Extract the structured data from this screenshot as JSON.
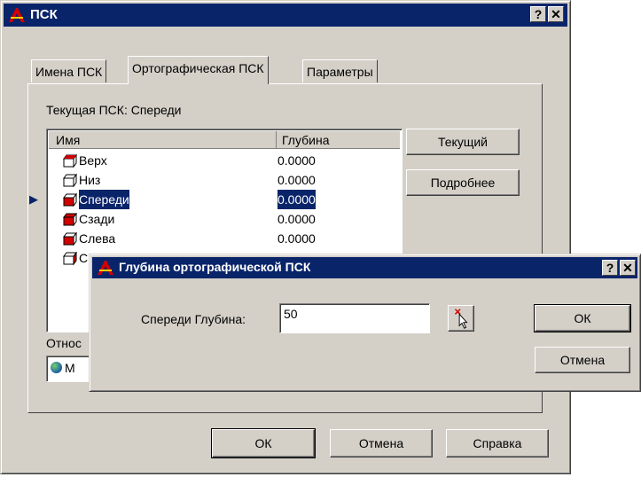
{
  "main_dialog": {
    "title": "ПСК",
    "help_btn": "?",
    "close_btn": "✕",
    "tabs": [
      "Имена ПСК",
      "Ортографическая ПСК",
      "Параметры"
    ],
    "current_label": "Текущая ПСК:  Спереди",
    "columns": {
      "name": "Имя",
      "depth": "Глубина"
    },
    "rows": [
      {
        "name": "Верх",
        "depth": "0.0000"
      },
      {
        "name": "Низ",
        "depth": "0.0000"
      },
      {
        "name": "Спереди",
        "depth": "0.0000"
      },
      {
        "name": "Сзади",
        "depth": "0.0000"
      },
      {
        "name": "Слева",
        "depth": "0.0000"
      },
      {
        "name": "С",
        "depth": ""
      }
    ],
    "selected_row": 2,
    "current_button": "Текущий",
    "details_button": "Подробнее",
    "relative_label": "Относ",
    "relative_value": "М",
    "ok_button": "ОК",
    "cancel_button": "Отмена",
    "help_button": "Справка"
  },
  "depth_dialog": {
    "title": "Глубина ортографической ПСК",
    "help_btn": "?",
    "close_btn": "✕",
    "field_label": "Спереди  Глубина:",
    "field_value": "50",
    "ok_button": "ОК",
    "cancel_button": "Отмена"
  },
  "colors": {
    "titlebar": "#0a246a",
    "face": "#d4d0c8",
    "selection": "#0a246a",
    "accent_icon": "#d40000"
  }
}
